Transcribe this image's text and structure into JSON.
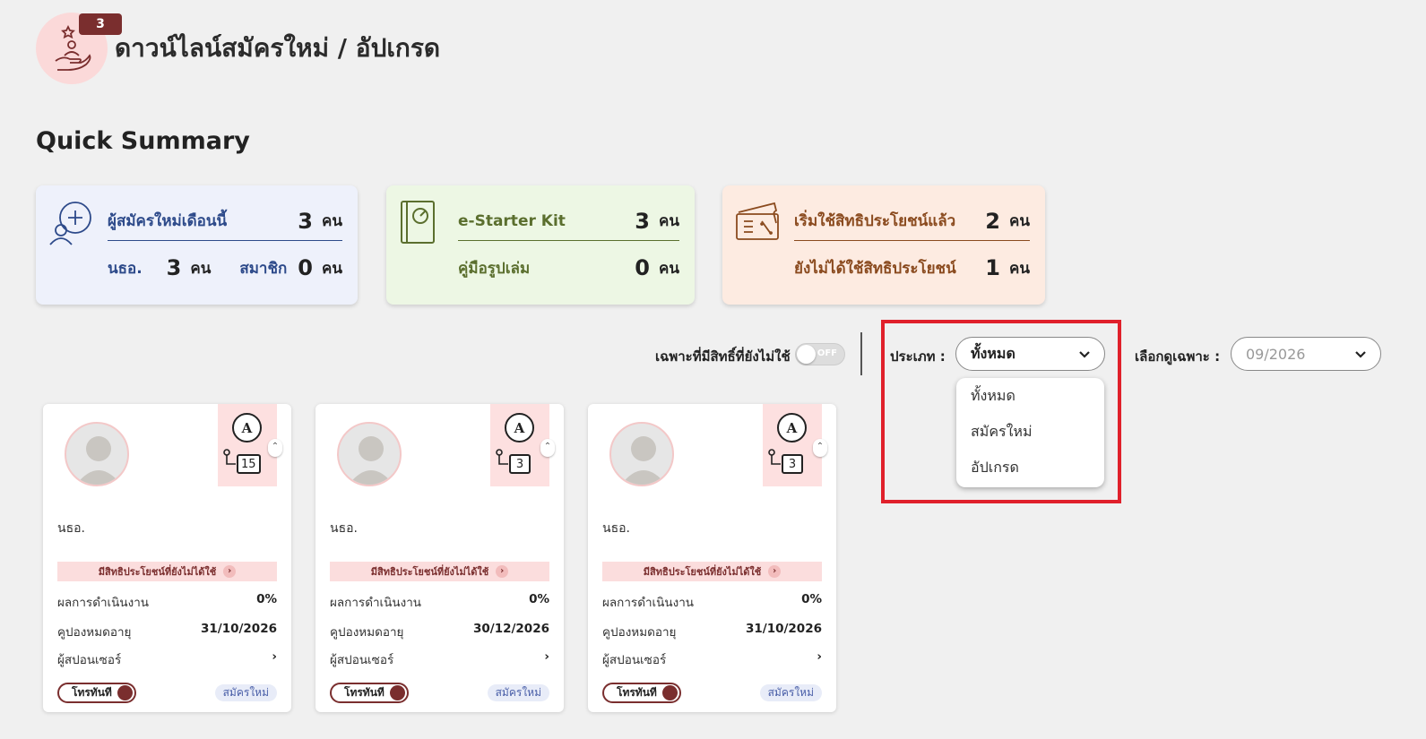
{
  "header": {
    "badge": "3",
    "title": "ดาวน์ไลน์สมัครใหม่ / อัปเกรด"
  },
  "section_title": "Quick Summary",
  "summary": {
    "new_members": {
      "label": "ผู้สมัครใหม่เดือนนี้",
      "value": "3",
      "unit": "คน",
      "sub1_label": "นธอ.",
      "sub1_value": "3",
      "sub1_unit": "คน",
      "sub2_label": "สมาชิก",
      "sub2_value": "0",
      "sub2_unit": "คน"
    },
    "starter_kit": {
      "label": "e-Starter Kit",
      "value": "3",
      "unit": "คน",
      "label2": "คู่มือรูปเล่ม",
      "value2": "0",
      "unit2": "คน"
    },
    "benefits": {
      "label": "เริ่มใช้สิทธิประโยชน์แล้ว",
      "value": "2",
      "unit": "คน",
      "label2": "ยังไม่ได้ใช้สิทธิประโยชน์",
      "value2": "1",
      "unit2": "คน"
    }
  },
  "filters": {
    "toggle_label": "เฉพาะที่มีสิทธิ์ที่ยังไม่ใช้",
    "toggle_state": "OFF",
    "type_label": "ประเภท :",
    "type_value": "ทั้งหมด",
    "type_options": [
      "ทั้งหมด",
      "สมัครใหม่",
      "อัปเกรด"
    ],
    "month_label": "เลือกดูเฉพาะ :",
    "month_value": "09/2026"
  },
  "cards": [
    {
      "rank": "A",
      "count": "15",
      "role": "นธอ.",
      "benefit": "มีสิทธิประโยชน์ที่ยังไม่ได้ใช้",
      "perf_label": "ผลการดำเนินงาน",
      "perf_value": "0%",
      "coupon_label": "คูปองหมดอายุ",
      "coupon_value": "31/10/2026",
      "sponsor_label": "ผู้สปอนเซอร์",
      "call_label": "โทรทันที",
      "tag": "สมัครใหม่"
    },
    {
      "rank": "A",
      "count": "3",
      "role": "นธอ.",
      "benefit": "มีสิทธิประโยชน์ที่ยังไม่ได้ใช้",
      "perf_label": "ผลการดำเนินงาน",
      "perf_value": "0%",
      "coupon_label": "คูปองหมดอายุ",
      "coupon_value": "30/12/2026",
      "sponsor_label": "ผู้สปอนเซอร์",
      "call_label": "โทรทันที",
      "tag": "สมัครใหม่"
    },
    {
      "rank": "A",
      "count": "3",
      "role": "นธอ.",
      "benefit": "มีสิทธิประโยชน์ที่ยังไม่ได้ใช้",
      "perf_label": "ผลการดำเนินงาน",
      "perf_value": "0%",
      "coupon_label": "คูปองหมดอายุ",
      "coupon_value": "31/10/2026",
      "sponsor_label": "ผู้สปอนเซอร์",
      "call_label": "โทรทันที",
      "tag": "สมัครใหม่"
    }
  ]
}
